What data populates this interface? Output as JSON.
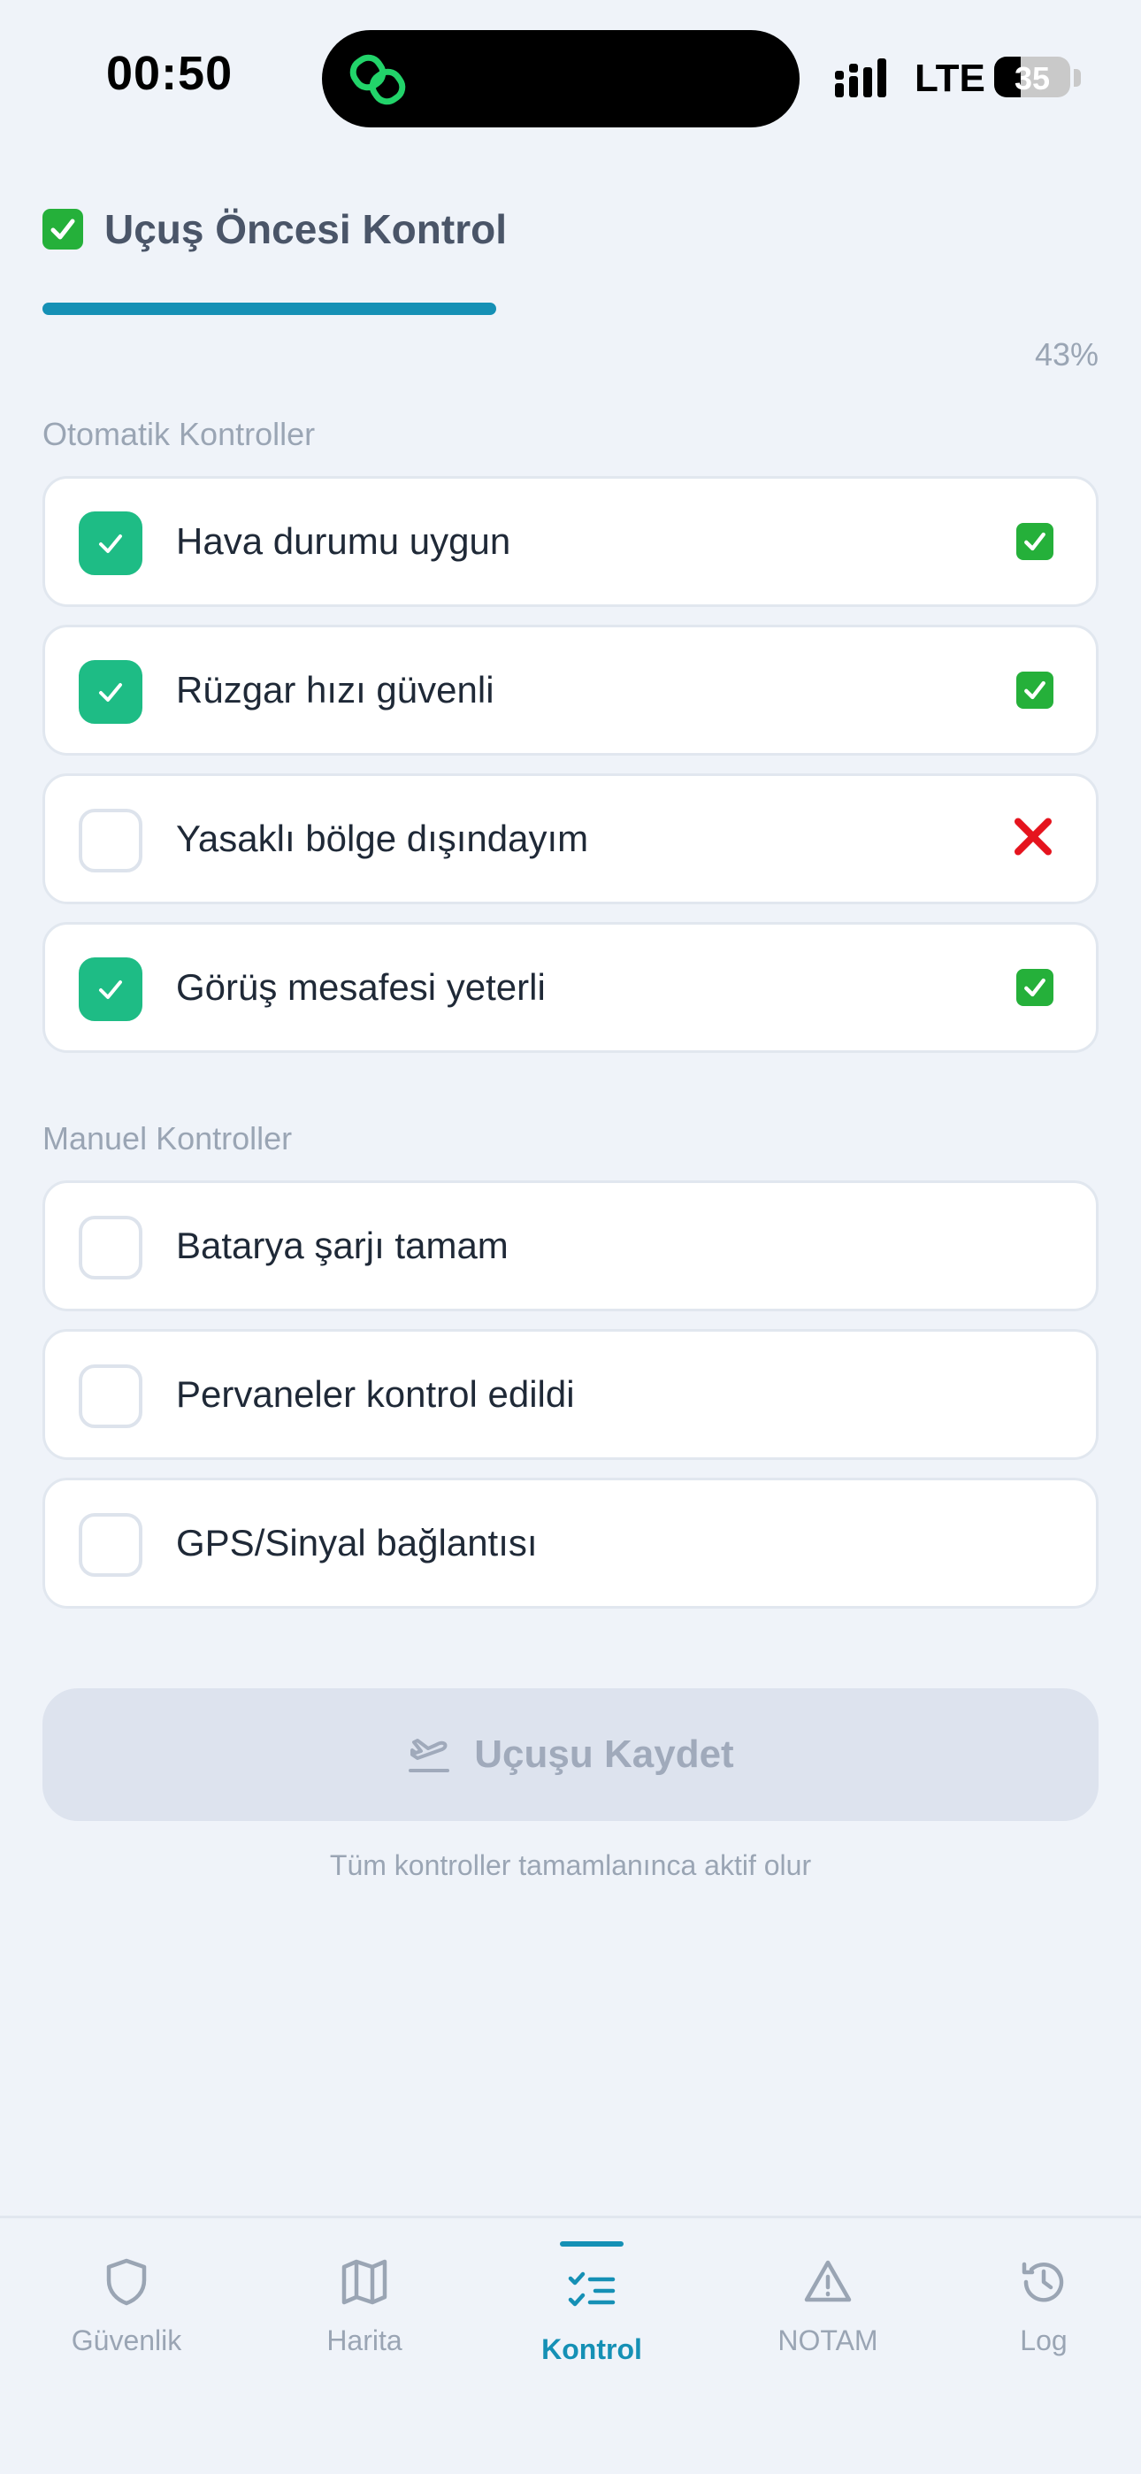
{
  "status_bar": {
    "time": "00:50",
    "network": "LTE",
    "battery": "35",
    "battery_level": 0.35
  },
  "header": {
    "title": "Uçuş Öncesi Kontrol",
    "title_icon": "green-check-emoji",
    "progress": 0.43,
    "progress_text": "43%"
  },
  "automatic": {
    "label": "Otomatik Kontroller",
    "items": [
      {
        "label": "Hava durumu uygun",
        "checked": true,
        "status": "pass"
      },
      {
        "label": "Rüzgar hızı güvenli",
        "checked": true,
        "status": "pass"
      },
      {
        "label": "Yasaklı bölge dışındayım",
        "checked": false,
        "status": "fail"
      },
      {
        "label": "Görüş mesafesi yeterli",
        "checked": true,
        "status": "pass"
      }
    ]
  },
  "manual": {
    "label": "Manuel Kontroller",
    "items": [
      {
        "label": "Batarya şarjı tamam",
        "checked": false
      },
      {
        "label": "Pervaneler kontrol edildi",
        "checked": false
      },
      {
        "label": "GPS/Sinyal bağlantısı",
        "checked": false
      }
    ]
  },
  "save": {
    "label": "Uçuşu Kaydet",
    "icon": "takeoff-icon",
    "disabled": true,
    "hint": "Tüm kontroller tamamlanınca aktif olur"
  },
  "nav": {
    "items": [
      {
        "label": "Güvenlik",
        "icon": "shield-icon"
      },
      {
        "label": "Harita",
        "icon": "map-icon"
      },
      {
        "label": "Kontrol",
        "icon": "checklist-icon",
        "active": true
      },
      {
        "label": "NOTAM",
        "icon": "warning-icon"
      },
      {
        "label": "Log",
        "icon": "history-icon"
      }
    ]
  },
  "colors": {
    "accent": "#1590b5",
    "check_green": "#1ebc85",
    "emoji_green": "#25b03a",
    "fail_red": "#e5141e",
    "background": "#eff3f9"
  }
}
